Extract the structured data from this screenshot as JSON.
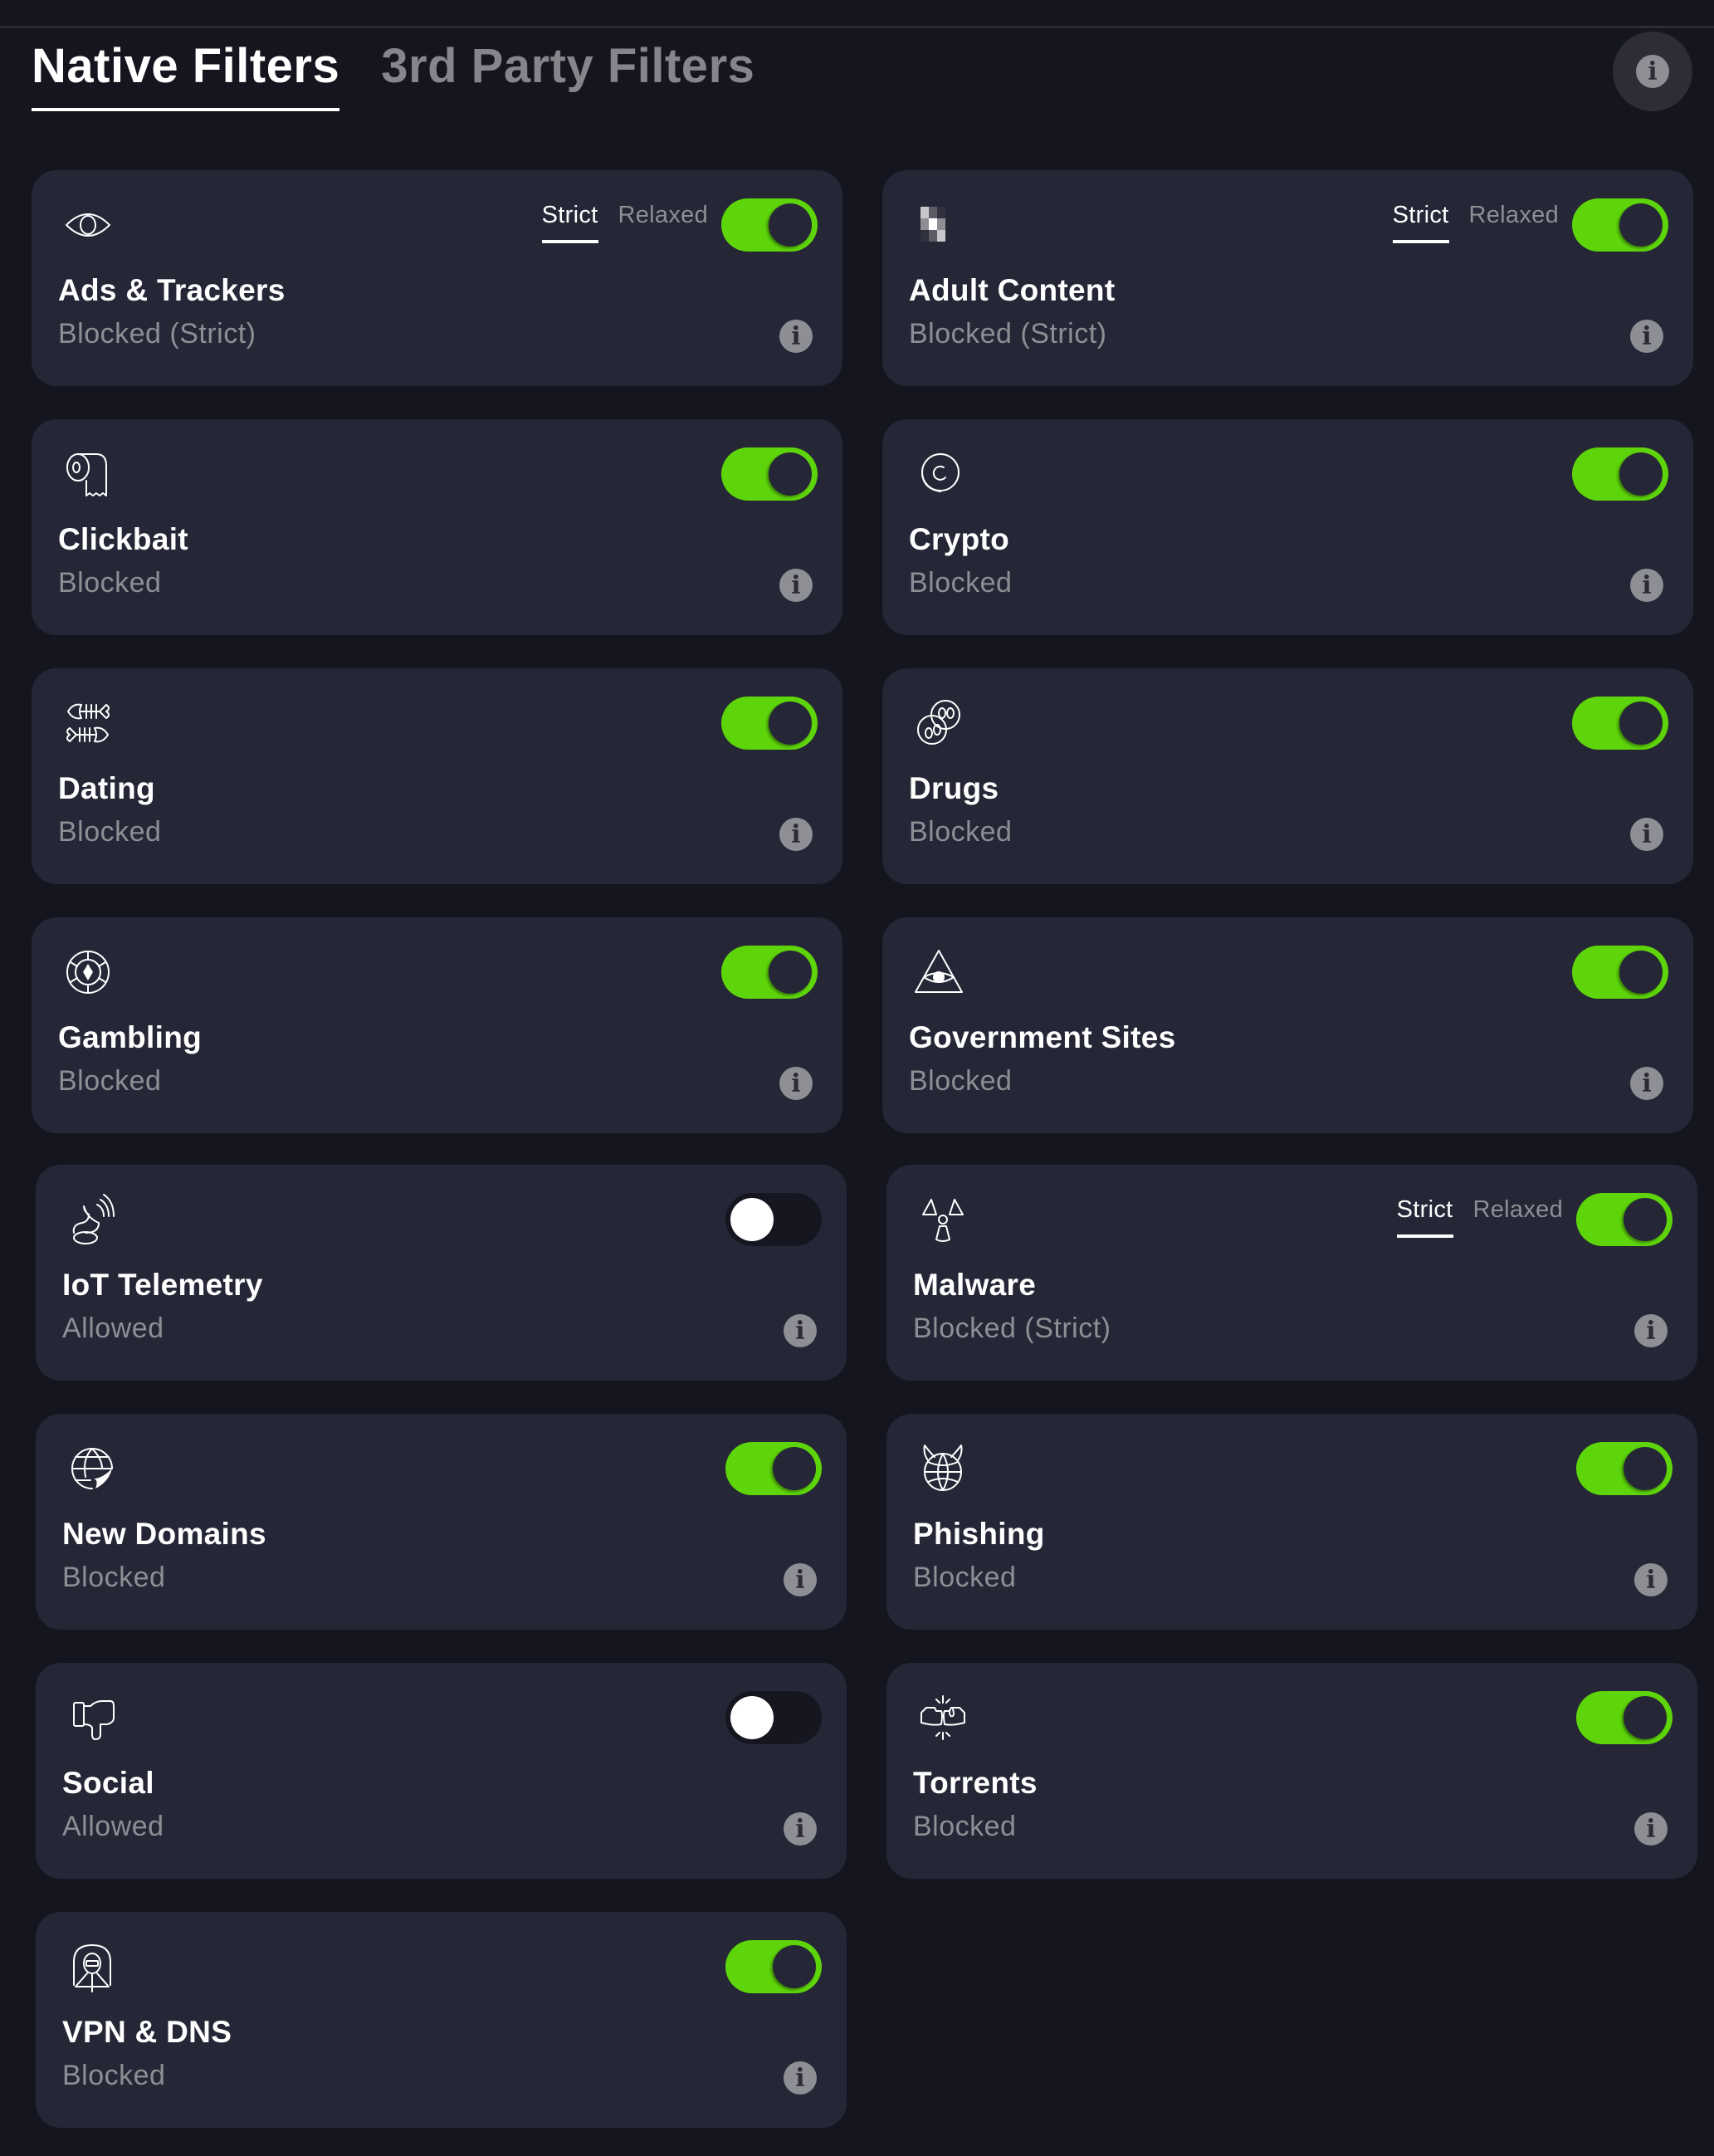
{
  "tabs": [
    {
      "label": "Native Filters",
      "active": true
    },
    {
      "label": "3rd Party Filters",
      "active": false
    }
  ],
  "page_info_icon": "info-icon",
  "colors": {
    "background": "#14151e",
    "card": "#252736",
    "toggle_on": "#5ed50a",
    "toggle_off": "#15161f",
    "muted_text": "#8e8e95"
  },
  "mode_labels": {
    "strict": "Strict",
    "relaxed": "Relaxed"
  },
  "filters": [
    {
      "name": "Ads & Trackers",
      "status": "Blocked (Strict)",
      "icon": "eye-icon",
      "enabled": true,
      "has_mode": true,
      "mode": "Strict"
    },
    {
      "name": "Adult Content",
      "status": "Blocked (Strict)",
      "icon": "pixelated-icon",
      "enabled": true,
      "has_mode": true,
      "mode": "Strict"
    },
    {
      "name": "Clickbait",
      "status": "Blocked",
      "icon": "toilet-paper-icon",
      "enabled": true,
      "has_mode": false
    },
    {
      "name": "Crypto",
      "status": "Blocked",
      "icon": "coin-icon",
      "enabled": true,
      "has_mode": false
    },
    {
      "name": "Dating",
      "status": "Blocked",
      "icon": "fish-bones-icon",
      "enabled": true,
      "has_mode": false
    },
    {
      "name": "Drugs",
      "status": "Blocked",
      "icon": "pills-icon",
      "enabled": true,
      "has_mode": false
    },
    {
      "name": "Gambling",
      "status": "Blocked",
      "icon": "poker-chip-icon",
      "enabled": true,
      "has_mode": false
    },
    {
      "name": "Government Sites",
      "status": "Blocked",
      "icon": "pyramid-eye-icon",
      "enabled": true,
      "has_mode": false
    },
    {
      "name": "IoT Telemetry",
      "status": "Allowed",
      "icon": "signal-dish-icon",
      "enabled": false,
      "has_mode": false
    },
    {
      "name": "Malware",
      "status": "Blocked (Strict)",
      "icon": "radiation-icon",
      "enabled": true,
      "has_mode": true,
      "mode": "Strict"
    },
    {
      "name": "New Domains",
      "status": "Blocked",
      "icon": "globe-sticker-icon",
      "enabled": true,
      "has_mode": false
    },
    {
      "name": "Phishing",
      "status": "Blocked",
      "icon": "devil-globe-icon",
      "enabled": true,
      "has_mode": false
    },
    {
      "name": "Social",
      "status": "Allowed",
      "icon": "thumbs-down-icon",
      "enabled": false,
      "has_mode": false
    },
    {
      "name": "Torrents",
      "status": "Blocked",
      "icon": "fist-bump-icon",
      "enabled": true,
      "has_mode": false
    },
    {
      "name": "VPN & DNS",
      "status": "Blocked",
      "icon": "tunnel-icon",
      "enabled": true,
      "has_mode": false
    }
  ]
}
